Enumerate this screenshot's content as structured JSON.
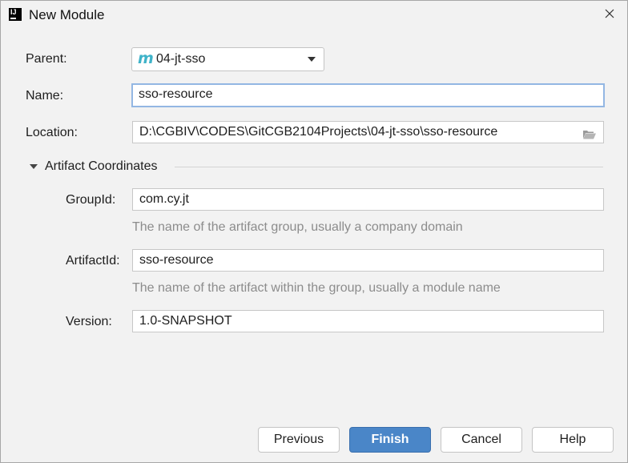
{
  "window": {
    "title": "New Module"
  },
  "form": {
    "parent": {
      "label": "Parent:",
      "value": "04-jt-sso",
      "icon": "maven-module-icon"
    },
    "name": {
      "label": "Name:",
      "value": "sso-resource"
    },
    "location": {
      "label": "Location:",
      "value": "D:\\CGBIV\\CODES\\GitCGB2104Projects\\04-jt-sso\\sso-resource",
      "icon": "folder-icon"
    }
  },
  "artifact": {
    "section_title": "Artifact Coordinates",
    "expanded": true,
    "group_id": {
      "label": "GroupId:",
      "value": "com.cy.jt",
      "hint": "The name of the artifact group, usually a company domain"
    },
    "artifact_id": {
      "label": "ArtifactId:",
      "value": "sso-resource",
      "hint": "The name of the artifact within the group, usually a module name"
    },
    "version": {
      "label": "Version:",
      "value": "1.0-SNAPSHOT"
    }
  },
  "buttons": {
    "previous": "Previous",
    "finish": "Finish",
    "cancel": "Cancel",
    "help": "Help"
  },
  "colors": {
    "primary_button": "#4a86c8",
    "focus_border": "#93b7e3",
    "maven_icon": "#3fb3c9",
    "hint_text": "#8c8c8c"
  }
}
